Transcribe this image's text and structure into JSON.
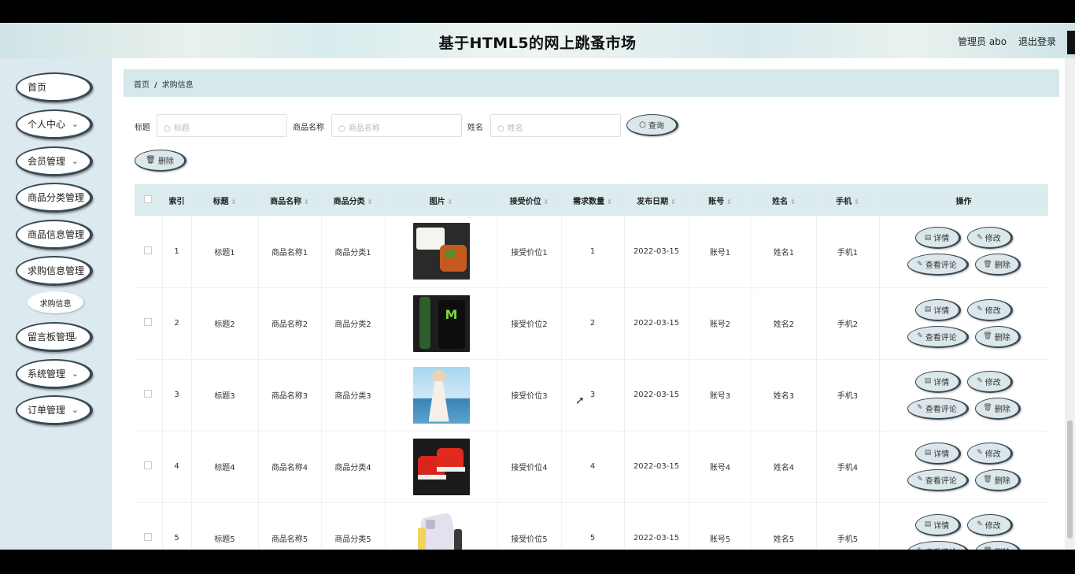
{
  "header": {
    "title": "基于HTML5的网上跳蚤市场",
    "admin": "管理员 abo",
    "logout": "退出登录"
  },
  "sidebar": {
    "items": [
      {
        "label": "首页",
        "chevron": false
      },
      {
        "label": "个人中心",
        "chevron": true
      },
      {
        "label": "会员管理",
        "chevron": true
      },
      {
        "label": "商品分类管理",
        "chevron": false
      },
      {
        "label": "商品信息管理",
        "chevron": false
      },
      {
        "label": "求购信息管理",
        "chevron": false
      },
      {
        "label": "留言板管理",
        "chevron": true
      },
      {
        "label": "系统管理",
        "chevron": true
      },
      {
        "label": "订单管理",
        "chevron": true
      }
    ],
    "sub_item": "求购信息",
    "chevron_glyph": "⌄"
  },
  "breadcrumb": {
    "home": "首页",
    "sep": "/",
    "current": "求购信息"
  },
  "search": {
    "title_label": "标题",
    "title_placeholder": "标题",
    "name_label": "商品名称",
    "name_placeholder": "商品名称",
    "person_label": "姓名",
    "person_placeholder": "姓名",
    "query_button": "查询",
    "search_icon": "search-icon"
  },
  "toolbar": {
    "delete_button": "删除",
    "trash_icon": "trash-icon"
  },
  "table": {
    "headers": [
      "索引",
      "标题",
      "商品名称",
      "商品分类",
      "图片",
      "接受价位",
      "需求数量",
      "发布日期",
      "账号",
      "姓名",
      "手机",
      "操作"
    ],
    "rows": [
      {
        "index": "1",
        "title": "标题1",
        "name": "商品名称1",
        "category": "商品分类1",
        "image": "food-photo",
        "price": "接受价位1",
        "qty": "1",
        "date": "2022-03-15",
        "account": "账号1",
        "person": "姓名1",
        "phone": "手机1"
      },
      {
        "index": "2",
        "title": "标题2",
        "name": "商品名称2",
        "category": "商品分类2",
        "image": "drink-can-photo",
        "price": "接受价位2",
        "qty": "2",
        "date": "2022-03-15",
        "account": "账号2",
        "person": "姓名2",
        "phone": "手机2"
      },
      {
        "index": "3",
        "title": "标题3",
        "name": "商品名称3",
        "category": "商品分类3",
        "image": "dress-photo",
        "price": "接受价位3",
        "qty": "3",
        "date": "2022-03-15",
        "account": "账号3",
        "person": "姓名3",
        "phone": "手机3"
      },
      {
        "index": "4",
        "title": "标题4",
        "name": "商品名称4",
        "category": "商品分类4",
        "image": "sneakers-photo",
        "price": "接受价位4",
        "qty": "4",
        "date": "2022-03-15",
        "account": "账号4",
        "person": "姓名4",
        "phone": "手机4"
      },
      {
        "index": "5",
        "title": "标题5",
        "name": "商品名称5",
        "category": "商品分类5",
        "image": "phone-photo",
        "price": "接受价位5",
        "qty": "5",
        "date": "2022-03-15",
        "account": "账号5",
        "person": "姓名5",
        "phone": "手机5"
      }
    ],
    "actions": {
      "detail": "详情",
      "edit": "修改",
      "comments": "查看评论",
      "delete": "删除"
    }
  },
  "colors": {
    "accent_bg": "#dcebee",
    "button_bg": "#dbe7ea",
    "button_border": "#3a4a55"
  }
}
